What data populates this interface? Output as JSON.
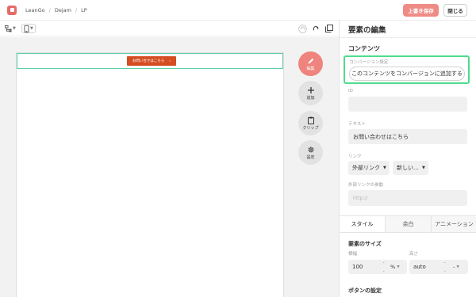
{
  "header": {
    "breadcrumbs": [
      "LeanGo",
      "Dejam",
      "LP"
    ],
    "save_label": "上書き保存",
    "close_label": "閉じる"
  },
  "canvas": {
    "cta_label": "お問い合せはこちら",
    "cta_arrow": "›"
  },
  "fabs": {
    "edit": "編集",
    "add": "追加",
    "clip": "クリップ",
    "settings": "設定"
  },
  "panel": {
    "title": "要素の編集",
    "section_title": "コンテンツ",
    "conversion_label": "コンバージョン設定",
    "conversion_button": "このコンテンツをコンバージョンに追加する",
    "id_label": "ID",
    "id_value": "",
    "text_label": "テキスト",
    "text_value": "お問い合わせはこちら",
    "link_label": "リンク",
    "link_type": "外部リンク",
    "link_target": "新しい…",
    "external_link_label": "外部リンクの参動",
    "external_link_placeholder": "http://",
    "tabs": [
      "スタイル",
      "余白",
      "アニメーション"
    ],
    "size_title": "要素のサイズ",
    "width_label": "横幅",
    "width_value": "100",
    "width_unit": "%",
    "height_label": "高さ",
    "height_value": "auto",
    "height_unit": "-",
    "button_settings_title": "ボタンの設定"
  },
  "colors": {
    "accent": "#ef837d",
    "cta": "#d64d22",
    "highlight": "#4fdb8d",
    "selection": "#5ccfa6"
  }
}
